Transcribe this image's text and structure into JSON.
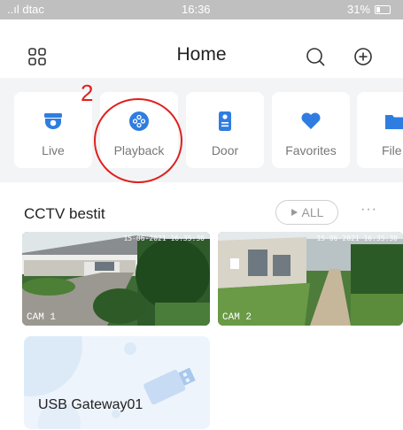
{
  "status_bar": {
    "carrier": "..ıl dtac",
    "time": "16:36",
    "battery": "31%"
  },
  "header": {
    "title": "Home"
  },
  "categories": [
    {
      "label": "Live",
      "icon": "camera-icon",
      "color": "#2f7de1"
    },
    {
      "label": "Playback",
      "icon": "playback-icon",
      "color": "#2f7de1"
    },
    {
      "label": "Door",
      "icon": "door-station-icon",
      "color": "#2f7de1"
    },
    {
      "label": "Favorites",
      "icon": "heart-icon",
      "color": "#2f7de1"
    },
    {
      "label": "File",
      "icon": "folder-icon",
      "color": "#2f7de1"
    }
  ],
  "annotation": {
    "number": "2",
    "color": "#e0201e"
  },
  "section": {
    "title": "CCTV bestit",
    "all_label": "ALL",
    "more": "···"
  },
  "cameras": [
    {
      "label": "CAM 1",
      "timestamp": "15-06-2021 16:35:30"
    },
    {
      "label": "CAM 2",
      "timestamp": "15-06-2021 16:35:30"
    }
  ],
  "gateway": {
    "label": "USB Gateway01"
  }
}
